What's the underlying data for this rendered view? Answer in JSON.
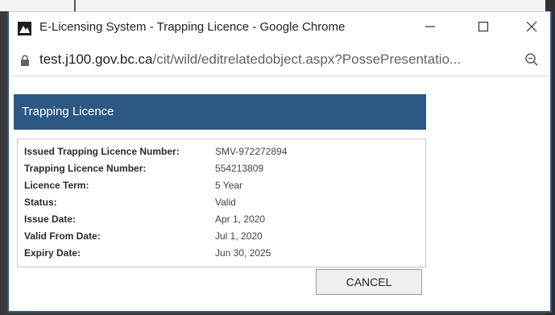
{
  "window": {
    "title": "E-Licensing System - Trapping Licence - Google Chrome"
  },
  "address": {
    "host": "test.j100.gov.bc.ca",
    "path": "/cit/wild/editrelatedobject.aspx?PossePresentatio..."
  },
  "panel": {
    "title": "Trapping Licence"
  },
  "fields": [
    {
      "label": "Issued Trapping Licence Number:",
      "value": "SMV-972272894"
    },
    {
      "label": "Trapping Licence Number:",
      "value": "554213809"
    },
    {
      "label": "Licence Term:",
      "value": "5 Year"
    },
    {
      "label": "Status:",
      "value": "Valid"
    },
    {
      "label": "Issue Date:",
      "value": "Apr 1, 2020"
    },
    {
      "label": "Valid From Date:",
      "value": "Jul 1, 2020"
    },
    {
      "label": "Expiry Date:",
      "value": "Jun 30, 2025"
    }
  ],
  "actions": {
    "cancel_label": "CANCEL"
  },
  "icons": {
    "app": "app-logo-icon",
    "minimize": "minimize-icon",
    "maximize": "maximize-icon",
    "close": "close-icon",
    "lock": "lock-icon",
    "zoom": "zoom-out-icon"
  }
}
